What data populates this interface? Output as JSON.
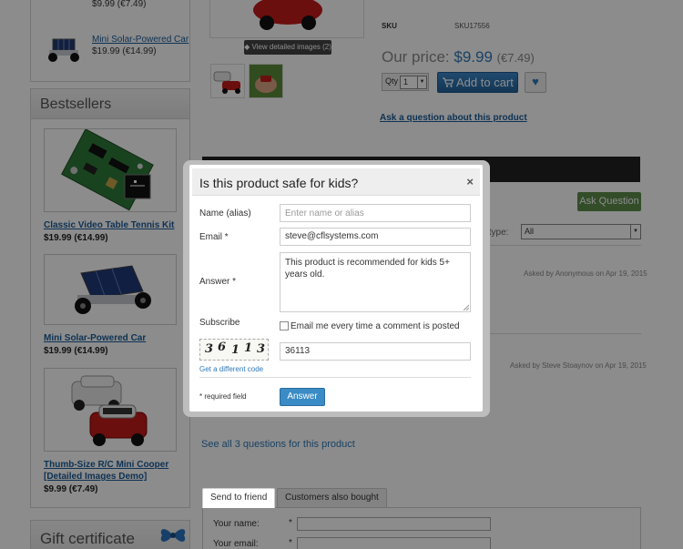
{
  "top_box": {
    "price_only": "$9.99 (€7.49)",
    "item": {
      "name": "Mini Solar-Powered Car",
      "price": "$19.99 (€14.99)"
    }
  },
  "bestsellers": {
    "title": "Bestsellers",
    "items": [
      {
        "name": "Classic Video Table Tennis Kit",
        "price": "$19.99 (€14.99)"
      },
      {
        "name": "Mini Solar-Powered Car",
        "price": "$19.99 (€14.99)"
      },
      {
        "name": "Thumb-Size R/C Mini Cooper [Detailed Images Demo]",
        "price": "$9.99 (€7.49)"
      }
    ]
  },
  "gift_certificate": {
    "title": "Gift certificate"
  },
  "product": {
    "view_detailed": "View detailed images (2)",
    "sku_label": "SKU",
    "sku_value": "SKU17556",
    "price_label": "Our price:",
    "price": "$9.99",
    "price_alt": "(€7.49)",
    "qty_label": "Qty",
    "qty_value": "1",
    "add_to_cart": "Add to cart",
    "ask_link": "Ask a question about this product"
  },
  "questions": {
    "ask_button": "Ask Question",
    "sort_label": "y type:",
    "sort_value": "All",
    "asked_1": "Asked by Anonymous on Apr 19, 2015",
    "asked_2": "Asked by Steve Stoaynov on Apr 19, 2015",
    "see_all": "See all 3 questions for this product"
  },
  "tabs": {
    "items": [
      "Send to friend",
      "Customers also bought"
    ],
    "your_name": "Your name:",
    "your_email": "Your email:",
    "star": "*"
  },
  "dialog": {
    "title": "Is this product safe for kids?",
    "close": "×",
    "name_label": "Name (alias)",
    "name_placeholder": "Enter name or alias",
    "email_label": "Email *",
    "email_value": "steve@cflsystems.com",
    "answer_label": "Answer *",
    "answer_value": "This product is recommended for kids 5+ years old.",
    "subscribe_label": "Subscribe",
    "subscribe_text": "Email me every time a comment is posted",
    "captcha_digits": [
      "3",
      "6",
      "1",
      "1",
      "3"
    ],
    "captcha_value": "36113",
    "new_code": "Get a different code",
    "required_note": "* required field",
    "answer_button": "Answer"
  },
  "colors": {
    "accent": "#3a8bc6",
    "ask_green": "#5e8c4c",
    "link": "#1a5c99"
  }
}
